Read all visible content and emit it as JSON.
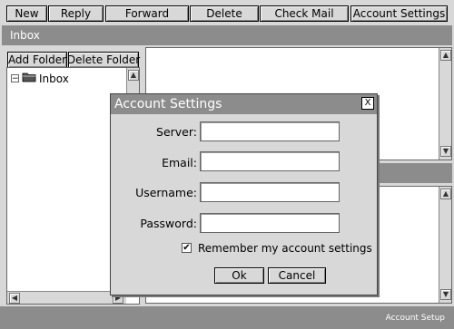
{
  "toolbar": {
    "new_label": "New",
    "reply_label": "Reply",
    "forward_label": "Forward",
    "delete_label": "Delete",
    "check_mail_label": "Check Mail",
    "account_settings_label": "Account Settings"
  },
  "section": {
    "title": "Inbox"
  },
  "folders": {
    "add_label": "Add Folder",
    "delete_label": "Delete Folder",
    "tree": [
      {
        "label": "Inbox",
        "icon": "folder-icon"
      }
    ]
  },
  "dialog": {
    "title": "Account Settings",
    "close_label": "X",
    "fields": {
      "server": {
        "label": "Server:",
        "value": ""
      },
      "email": {
        "label": "Email:",
        "value": ""
      },
      "username": {
        "label": "Username:",
        "value": ""
      },
      "password": {
        "label": "Password:",
        "value": ""
      }
    },
    "remember": {
      "label": "Remember my account settings",
      "checked": true,
      "mark": "✔"
    },
    "ok_label": "Ok",
    "cancel_label": "Cancel"
  },
  "statusbar": {
    "text": "Account Setup"
  },
  "colors": {
    "bar": "#8c8c8c",
    "panel": "#d8d8d8"
  }
}
